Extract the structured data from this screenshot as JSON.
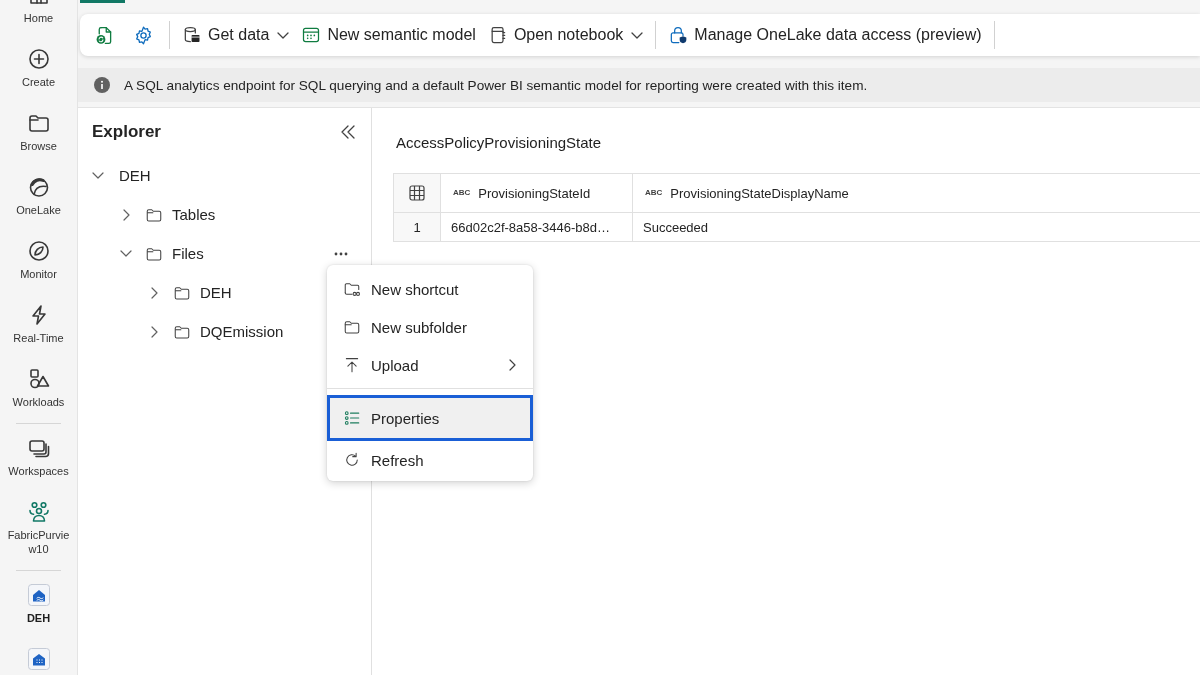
{
  "nav": {
    "groups": [
      [
        {
          "label": "Home",
          "selected": false
        },
        {
          "label": "Create",
          "selected": false
        },
        {
          "label": "Browse",
          "selected": false
        },
        {
          "label": "OneLake",
          "selected": false
        },
        {
          "label": "Monitor",
          "selected": false
        },
        {
          "label": "Real-Time",
          "selected": false
        },
        {
          "label": "Workloads",
          "selected": false
        }
      ],
      [
        {
          "label": "Workspaces",
          "selected": false
        },
        {
          "label": "FabricPurview10",
          "selected": false
        }
      ],
      [
        {
          "label": "DEH",
          "selected": true
        }
      ]
    ]
  },
  "toolbar": {
    "groups": [
      [
        {
          "label": "Get data",
          "dropdown": true
        },
        {
          "label": "New semantic model",
          "dropdown": false
        },
        {
          "label": "Open notebook",
          "dropdown": true
        }
      ],
      [
        {
          "label": "Manage OneLake data access (preview)",
          "dropdown": false
        }
      ]
    ]
  },
  "info_bar": {
    "message": "A SQL analytics endpoint for SQL querying and a default Power BI semantic model for reporting were created with this item."
  },
  "explorer": {
    "title": "Explorer",
    "tree": [
      {
        "label": "DEH",
        "expanded": true,
        "actions_shown": false,
        "children": [
          {
            "label": "Tables",
            "expanded": false,
            "actions_shown": false
          },
          {
            "label": "Files",
            "expanded": true,
            "actions_shown": true,
            "children": [
              {
                "label": "DEH",
                "expanded": false,
                "actions_shown": false
              },
              {
                "label": "DQEmission",
                "expanded": false,
                "actions_shown": false
              }
            ]
          }
        ]
      }
    ]
  },
  "context_menu": {
    "groups": [
      [
        {
          "label": "New shortcut",
          "submenu": false,
          "selected": false
        },
        {
          "label": "New subfolder",
          "submenu": false,
          "selected": false
        },
        {
          "label": "Upload",
          "submenu": true,
          "selected": false
        }
      ],
      [
        {
          "label": "Properties",
          "submenu": false,
          "selected": true
        },
        {
          "label": "Refresh",
          "submenu": false,
          "selected": false
        }
      ]
    ]
  },
  "content": {
    "title": "AccessPolicyProvisioningState",
    "table": {
      "columns": [
        {
          "type_label": "ABC",
          "name": "ProvisioningStateId"
        },
        {
          "type_label": "ABC",
          "name": "ProvisioningStateDisplayName"
        }
      ],
      "rows": [
        {
          "number": "1",
          "cells": [
            "66d02c2f-8a58-3446-b8d…",
            "Succeeded"
          ]
        }
      ]
    }
  }
}
